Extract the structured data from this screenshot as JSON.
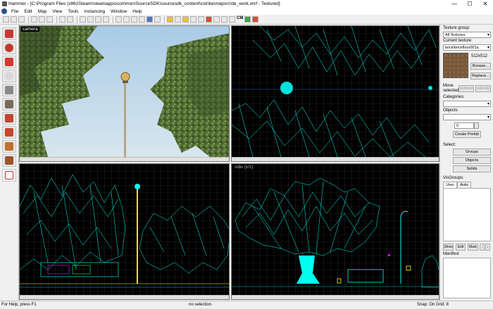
{
  "window": {
    "title": "Hammer - [C:\\Program Files (x86)\\Steam\\steamapps\\common\\SourceSDK\\sourcesdk_content\\cstrike\\mapsrc\\de_work.vmf - Textured]",
    "min_glyph": "—",
    "max_glyph": "☐",
    "close_glyph": "✕"
  },
  "menu": [
    "File",
    "Edit",
    "Map",
    "View",
    "Tools",
    "Instancing",
    "Window",
    "Help"
  ],
  "toolbar": {
    "cm_label": "CM"
  },
  "viewports": {
    "camera_label": "camera",
    "side_label": "side (x/z)"
  },
  "panel": {
    "texture_group_label": "Texture group:",
    "texture_group_value": "All Textures",
    "current_texture_label": "Current texture:",
    "current_texture_value": "brick/brickfloor001a",
    "texture_size": "512x512",
    "browse_button": "Browse...",
    "replace_button": "Replace...",
    "move_selected_label": "Move\nselected:",
    "to_world_button": "toWorld",
    "to_entity_button": "toEntity",
    "categories_label": "Categories:",
    "objects_label": "Objects:",
    "objects_value": "0",
    "create_prefab_button": "Create Prefab",
    "select_label": "Select:",
    "groups_button": "Groups",
    "objects_button": "Objects",
    "solids_button": "Solids",
    "visgroups_label": "VisGroups:",
    "tab_user": "User",
    "tab_auto": "Auto",
    "show_button": "Show",
    "edit_button": "Edit",
    "mark_button": "Mark",
    "manifest_label": "Manifest"
  },
  "status": {
    "help": "For Help, press F1",
    "selection": "no selection.",
    "snap": "Snap: On Grid: 8"
  },
  "icons": {
    "left_tools": [
      "selection-tool-icon",
      "magnify-tool-icon",
      "camera-tool-icon",
      "entity-tool-icon",
      "block-tool-icon",
      "texture-application-icon",
      "apply-decal-icon",
      "overlay-icon",
      "clipping-tool-icon",
      "vertex-tool-icon"
    ]
  }
}
